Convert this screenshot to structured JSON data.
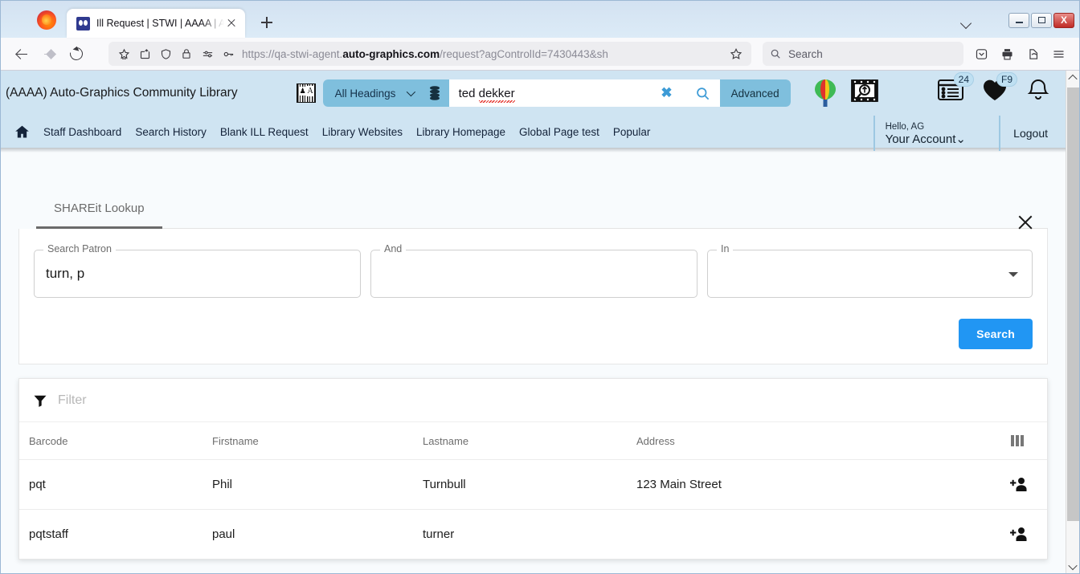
{
  "browser": {
    "tab": {
      "title": "Ill Request | STWI | AAAA | Auto",
      "favicon_name": "site-favicon"
    },
    "newtab_label": "+",
    "window_controls": {
      "minimize": "–",
      "maximize": "□",
      "close": "X"
    },
    "url": {
      "prefix": "https://qa-stwi-agent.",
      "domain": "auto-graphics.com",
      "path": "/request?agControlId=7430443&sh"
    },
    "search_placeholder": "Search",
    "icons": [
      "back-arrow",
      "forward-arrow",
      "reload",
      "bookmark-star",
      "save-to-pocket",
      "shield",
      "padlock",
      "permissions",
      "key",
      "star",
      "pocket",
      "print",
      "share",
      "menu"
    ]
  },
  "appheader": {
    "library_name": "(AAAA) Auto-Graphics Community Library",
    "barcode_icon_letter": "A",
    "search": {
      "scope_label": "All Headings",
      "query": "ted ",
      "query_misspelled": "dekker",
      "clear_label": "✖",
      "advanced_label": "Advanced"
    },
    "badges": {
      "list_count": "24",
      "favorites": "F9"
    },
    "account": {
      "greeting": "Hello, AG",
      "name": "Your Account"
    },
    "logout_label": "Logout",
    "nav": [
      {
        "label": "Staff Dashboard"
      },
      {
        "label": "Search History"
      },
      {
        "label": "Blank ILL Request"
      },
      {
        "label": "Library Websites"
      },
      {
        "label": "Library Homepage"
      },
      {
        "label": "Global Page test"
      },
      {
        "label": "Popular"
      }
    ]
  },
  "modal": {
    "close_label": "✕",
    "tab_label": "SHAREit Lookup",
    "form": {
      "search_patron": {
        "label": "Search Patron",
        "value": "turn, p",
        "placeholder": ""
      },
      "and": {
        "label": "And",
        "value": "",
        "placeholder": ""
      },
      "in": {
        "label": "In",
        "value": "",
        "placeholder": ""
      },
      "search_button": "Search"
    },
    "filter_placeholder": "Filter",
    "table": {
      "columns": [
        "Barcode",
        "Firstname",
        "Lastname",
        "Address"
      ],
      "rows": [
        {
          "barcode": "pqt",
          "firstname": "Phil",
          "lastname": "Turnbull",
          "address": "123 Main Street"
        },
        {
          "barcode": "pqtstaff",
          "firstname": "paul",
          "lastname": "turner",
          "address": ""
        }
      ]
    }
  },
  "colors": {
    "header_bg": "#cfe4f2",
    "accent_blue": "#2196f3",
    "search_chrome": "#7fbfdd",
    "page_bg": "#f8fbfd"
  }
}
